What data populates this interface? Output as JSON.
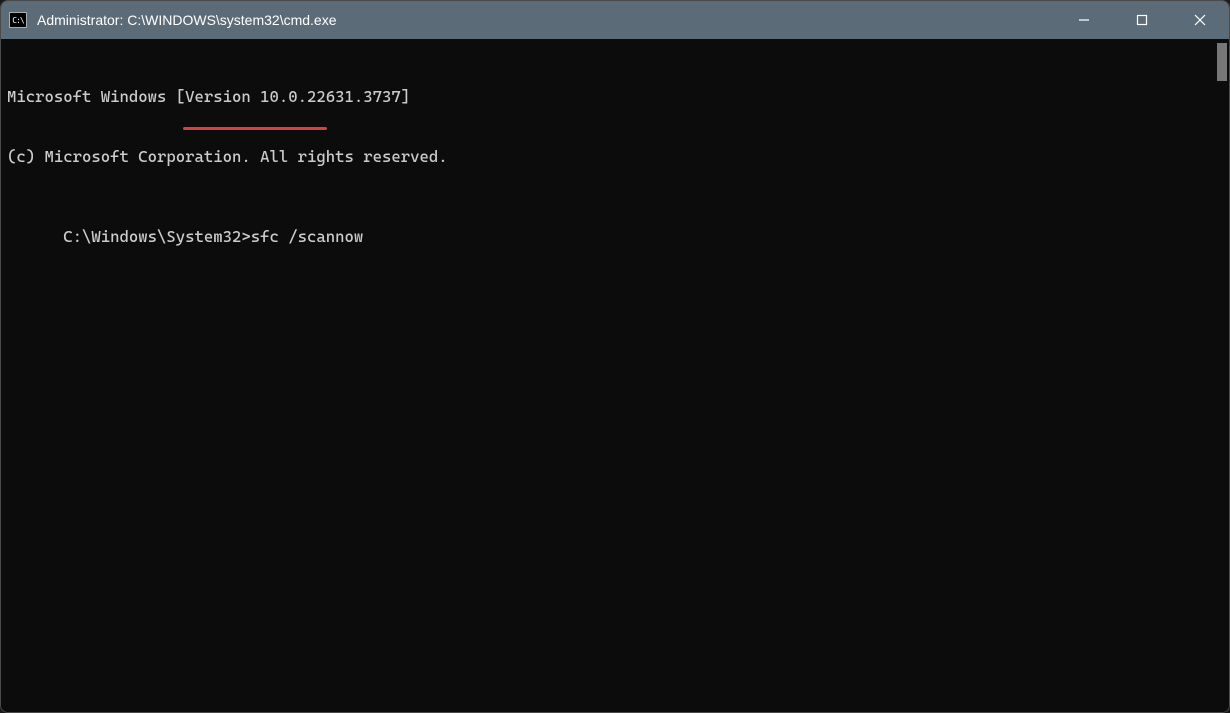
{
  "window": {
    "title": "Administrator: C:\\WINDOWS\\system32\\cmd.exe",
    "icon_label": "C:\\"
  },
  "terminal": {
    "line1": "Microsoft Windows [Version 10.0.22631.3737]",
    "line2": "(c) Microsoft Corporation. All rights reserved.",
    "blank": "",
    "prompt": "C:\\Windows\\System32>",
    "command": "sfc /scannow"
  },
  "annotation": {
    "underline_color": "#d84141"
  }
}
